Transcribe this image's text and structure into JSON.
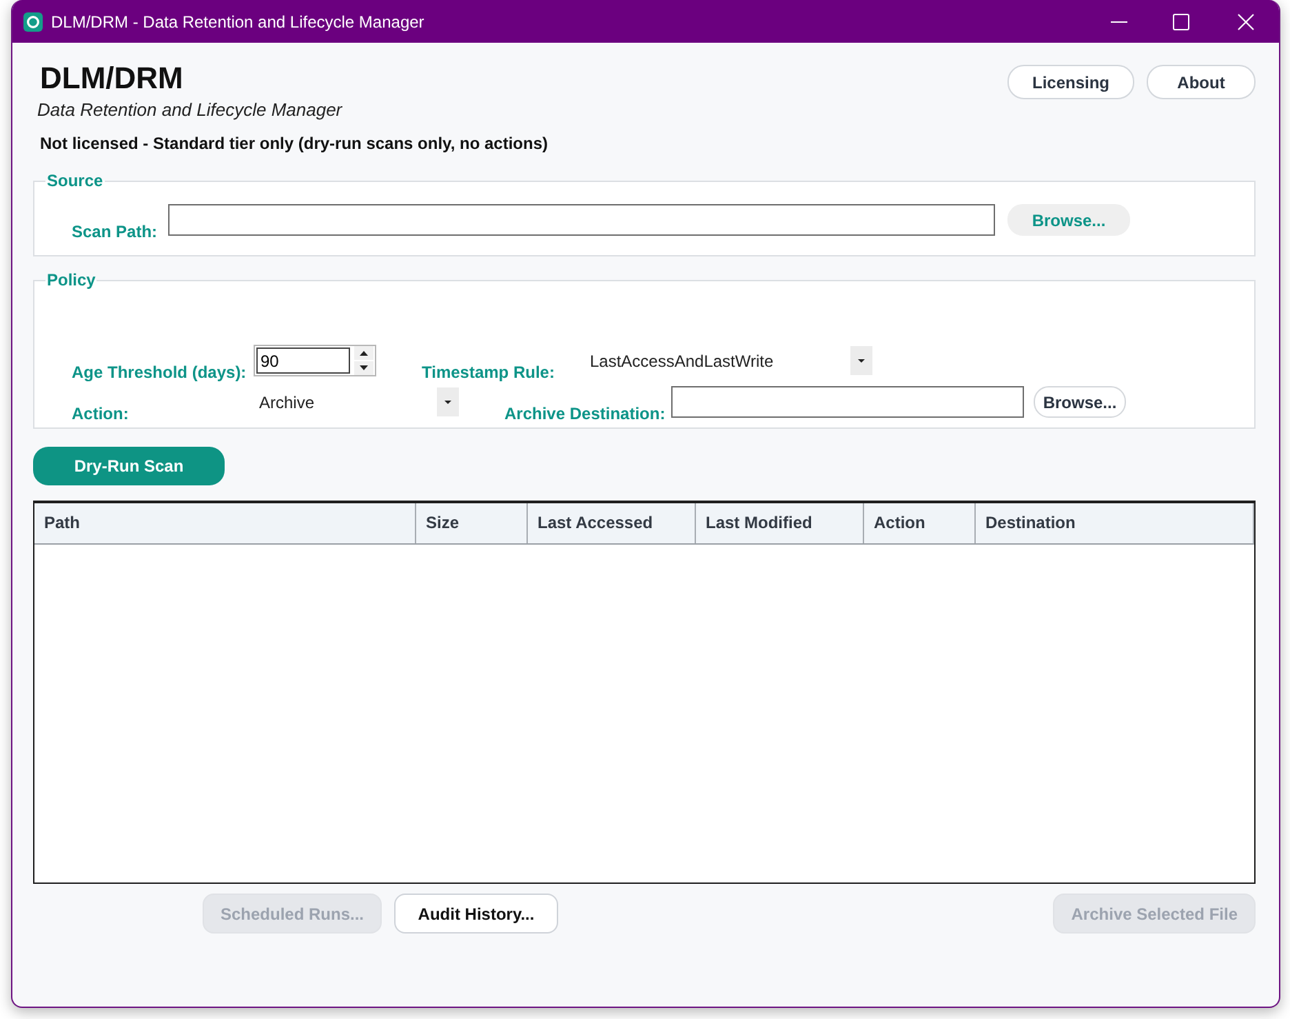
{
  "window": {
    "title": "DLM/DRM - Data Retention and Lifecycle Manager"
  },
  "header": {
    "app_name": "DLM/DRM",
    "subtitle": "Data Retention and Lifecycle Manager",
    "license_status": "Not licensed - Standard tier only (dry-run scans only, no actions)",
    "buttons": [
      {
        "label": "Licensing"
      },
      {
        "label": "About"
      }
    ]
  },
  "source": {
    "title": "Source",
    "scan_path": {
      "label": "Scan Path:"
    },
    "browse_button": {
      "label": "Browse...",
      "kind": "tonal"
    }
  },
  "policy": {
    "title": "Policy",
    "age_threshold": {
      "label": "Age Threshold (days):",
      "value": "90"
    },
    "timestamp_rule": {
      "label": "Timestamp Rule:",
      "value": "LastAccessAndLastWrite"
    },
    "action": {
      "label": "Action:",
      "value": "Archive"
    },
    "archive_destination": {
      "label": "Archive Destination:"
    },
    "browse_button": {
      "label": "Browse...",
      "kind": "outlined"
    }
  },
  "scan_button": {
    "label": "Dry-Run Scan"
  },
  "table": {
    "columns": [
      "Path",
      "Size",
      "Last Accessed",
      "Last Modified",
      "Action",
      "Destination"
    ]
  },
  "footer_buttons": [
    {
      "label": "Scheduled Runs...",
      "disabled": true
    },
    {
      "label": "Audit History...",
      "disabled": false
    },
    {
      "label": "Archive Selected File",
      "disabled": true
    }
  ]
}
